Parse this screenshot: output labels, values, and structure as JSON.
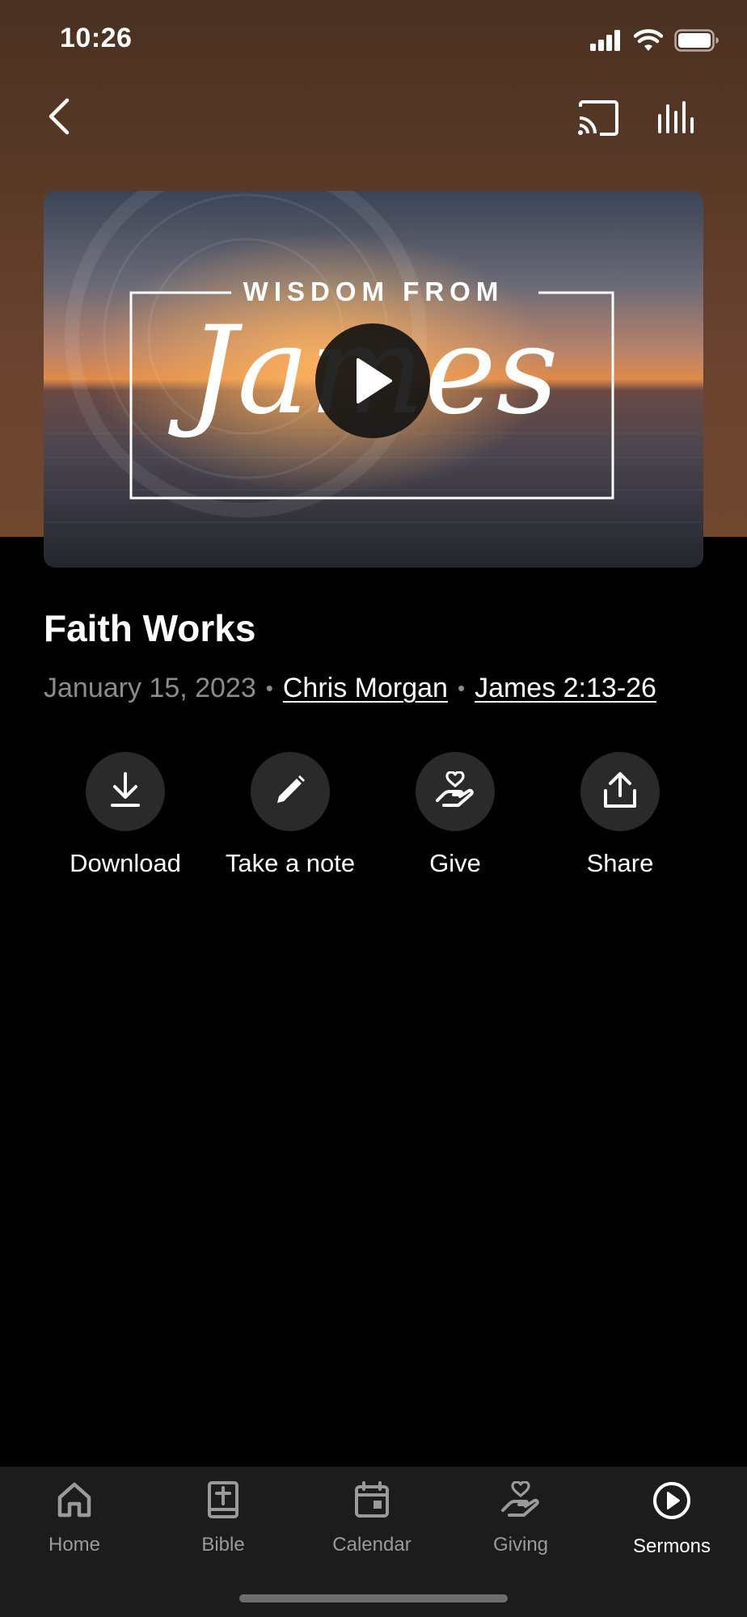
{
  "status_bar": {
    "time": "10:26"
  },
  "sermon": {
    "artwork_heading": "WISDOM FROM",
    "artwork_script": "James",
    "title": "Faith Works",
    "date": "January 15, 2023",
    "separator": "•",
    "speaker": "Chris Morgan",
    "scripture": "James 2:13-26"
  },
  "actions": [
    {
      "label": "Download",
      "icon": "download-icon"
    },
    {
      "label": "Take a note",
      "icon": "pencil-icon"
    },
    {
      "label": "Give",
      "icon": "giving-hand-icon"
    },
    {
      "label": "Share",
      "icon": "share-icon"
    }
  ],
  "tabs": [
    {
      "label": "Home",
      "icon": "home-icon",
      "active": false
    },
    {
      "label": "Bible",
      "icon": "bible-icon",
      "active": false
    },
    {
      "label": "Calendar",
      "icon": "calendar-icon",
      "active": false
    },
    {
      "label": "Giving",
      "icon": "giving-hand-icon",
      "active": false
    },
    {
      "label": "Sermons",
      "icon": "play-circle-icon",
      "active": true
    }
  ],
  "colors": {
    "header_brown": "#5a3a27",
    "background": "#000000",
    "tab_bar": "#1c1c1c",
    "inactive_tab": "#9a9a9a",
    "action_circle": "#2a2a2a"
  }
}
